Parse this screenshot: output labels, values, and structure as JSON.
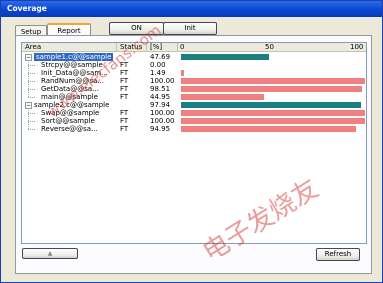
{
  "window": {
    "title": "Coverage"
  },
  "tabs": [
    {
      "label": "Setup"
    },
    {
      "label": "Report"
    }
  ],
  "toolbar": {
    "on_label": "ON",
    "init_label": "Init"
  },
  "table": {
    "columns": {
      "area": "Area",
      "status": "Status",
      "pct": "[%]"
    },
    "scale": {
      "min": "0",
      "mid": "50",
      "max": "100"
    },
    "rows": [
      {
        "name": "sample1.c@@sample",
        "status": "",
        "pct": "47.69",
        "value": 47.69,
        "color": "#1b7f7f",
        "level": 0,
        "selected": true
      },
      {
        "name": "Strcpy@@sample",
        "status": "FT",
        "pct": "0.00",
        "value": 0,
        "color": "#f08080",
        "level": 1
      },
      {
        "name": "Init_Data@@sam...",
        "status": "FT",
        "pct": "1.49",
        "value": 1.49,
        "color": "#f08080",
        "level": 1
      },
      {
        "name": "RandNum@@sa...",
        "status": "FT",
        "pct": "100.00",
        "value": 100,
        "color": "#f08080",
        "level": 1
      },
      {
        "name": "GetData@@sa...",
        "status": "FT",
        "pct": "98.51",
        "value": 98.51,
        "color": "#f08080",
        "level": 1
      },
      {
        "name": "main@@sample",
        "status": "FT",
        "pct": "44.95",
        "value": 44.95,
        "color": "#f08080",
        "level": 1
      },
      {
        "name": "sample2.c@@sample",
        "status": "",
        "pct": "97.94",
        "value": 97.94,
        "color": "#1b7f7f",
        "level": 0
      },
      {
        "name": "Swap@@sample",
        "status": "FT",
        "pct": "100.00",
        "value": 100,
        "color": "#f08080",
        "level": 1
      },
      {
        "name": "Sort@@sample",
        "status": "FT",
        "pct": "100.00",
        "value": 100,
        "color": "#f08080",
        "level": 1
      },
      {
        "name": "Reverse@@sa...",
        "status": "FT",
        "pct": "94.95",
        "value": 94.95,
        "color": "#f08080",
        "level": 1
      }
    ]
  },
  "footer": {
    "up_icon": "triangle-up-icon",
    "refresh_label": "Refresh"
  },
  "watermark": {
    "text": "电子发烧友",
    "url": "www.elecfans.com"
  }
}
